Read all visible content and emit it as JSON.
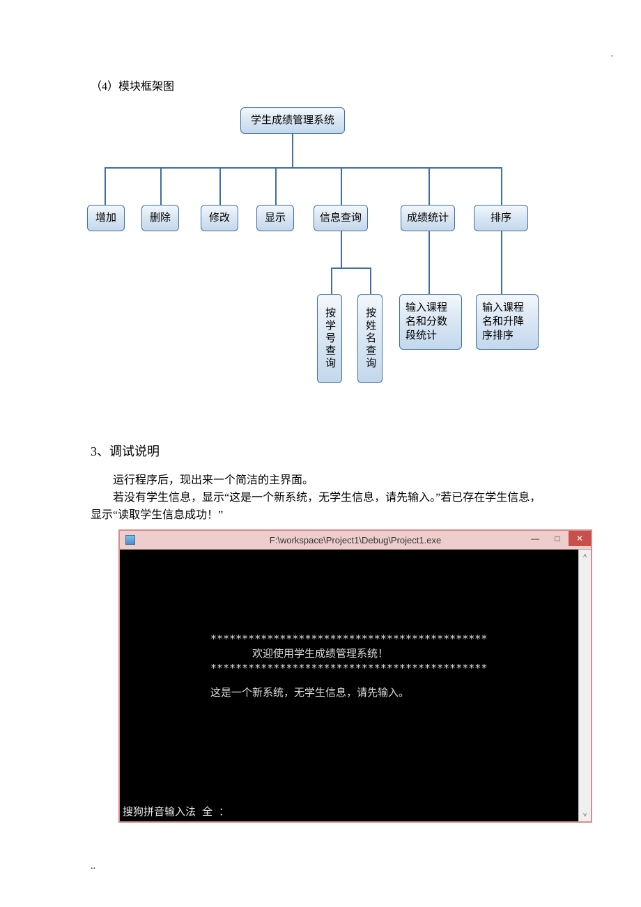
{
  "headings": {
    "h4": "（4）模块框架图",
    "h3": "3、调试说明"
  },
  "diagram": {
    "root": "学生成绩管理系统",
    "level1": [
      "增加",
      "删除",
      "修改",
      "显示",
      "信息查询",
      "成绩统计",
      "排序"
    ],
    "info_children": [
      "按学号查询",
      "按姓名查询"
    ],
    "stats_child": "输入课程名和分数段统计",
    "sort_child": "输入课程名和升降序排序"
  },
  "body": {
    "p1": "运行程序后，现出来一个简洁的主界面。",
    "p2": "若没有学生信息，显示“这是一个新系统，无学生信息，请先输入。”若已存在学生信息，显示“读取学生信息成功！”"
  },
  "console": {
    "title": "F:\\workspace\\Project1\\Debug\\Project1.exe",
    "stars": "********************************************",
    "welcome": "欢迎使用学生成绩管理系统！",
    "msg": "这是一个新系统，无学生信息，请先输入。",
    "ime": "搜狗拼音输入法  全 ："
  },
  "dots": {
    "top": ".",
    "bottom": ".."
  }
}
